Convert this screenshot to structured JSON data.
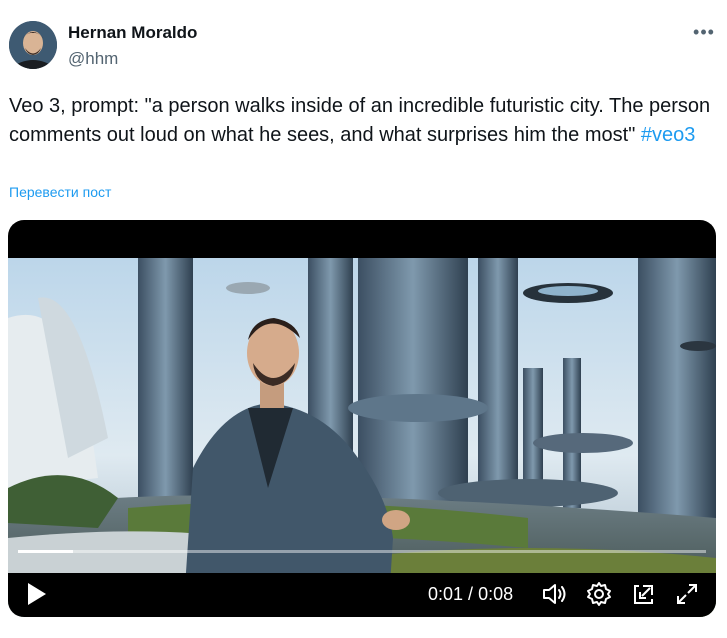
{
  "author": {
    "name": "Hernan Moraldo",
    "handle": "@hhm"
  },
  "post": {
    "text": "Veo 3, prompt: \"a person walks inside of an incredible futuristic city. The person comments out loud on what he sees, and what surprises him the most\" ",
    "hashtag": "#veo3",
    "translate_label": "Перевести пост"
  },
  "video": {
    "current_time": "0:01",
    "separator": " / ",
    "duration": "0:08",
    "progress_fraction": 0.08
  },
  "icons": {
    "more": "more-icon",
    "play": "play-icon",
    "volume": "volume-icon",
    "settings": "gear-icon",
    "pip": "picture-in-picture-icon",
    "fullscreen": "fullscreen-icon"
  }
}
